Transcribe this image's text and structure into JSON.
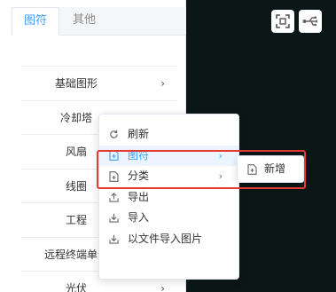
{
  "tabs": [
    {
      "label": "图符"
    },
    {
      "label": "其他"
    }
  ],
  "list": [
    {
      "label": "基础图形",
      "chevron": "›"
    },
    {
      "label": "冷却塔",
      "chevron": ""
    },
    {
      "label": "风扇",
      "chevron": ""
    },
    {
      "label": "线圈",
      "chevron": ""
    },
    {
      "label": "工程",
      "chevron": ""
    },
    {
      "label": "远程终端单元",
      "chevron": ""
    },
    {
      "label": "光伏",
      "chevron": "›"
    }
  ],
  "menu": {
    "items": [
      {
        "label": "刷新",
        "icon": "refresh-icon",
        "has_sub": false
      },
      {
        "label": "图符",
        "icon": "file-add-icon",
        "has_sub": true,
        "highlighted": true
      },
      {
        "label": "分类",
        "icon": "file-add-icon",
        "has_sub": true
      },
      {
        "label": "导出",
        "icon": "export-icon",
        "has_sub": false
      },
      {
        "label": "导入",
        "icon": "import-icon",
        "has_sub": false
      },
      {
        "label": "以文件导入图片",
        "icon": "import-icon",
        "has_sub": false
      }
    ],
    "submenu_arrow": "›"
  },
  "submenu": {
    "items": [
      {
        "label": "新增",
        "icon": "file-add-icon"
      }
    ]
  },
  "toolbar": {
    "icons": [
      "fit-screen-icon",
      "usb-icon"
    ]
  },
  "colors": {
    "accent": "#409eff",
    "canvas_bg": "#0b1717",
    "highlight_box": "#e53935"
  }
}
